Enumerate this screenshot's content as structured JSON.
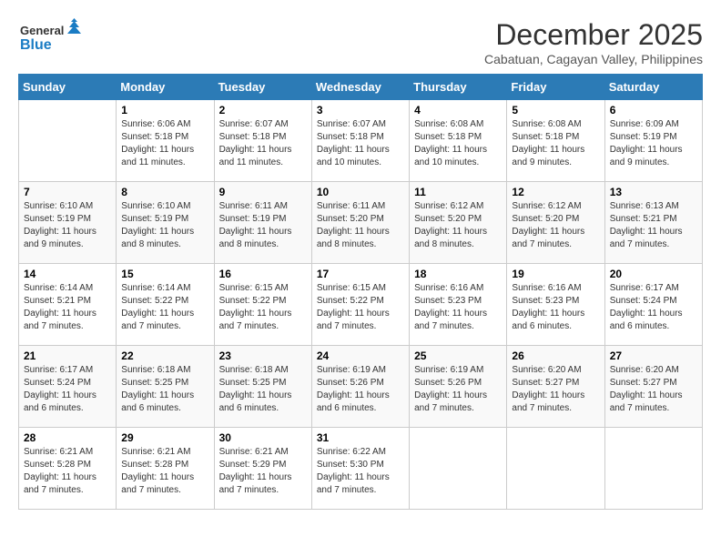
{
  "header": {
    "logo_line1": "General",
    "logo_line2": "Blue",
    "month": "December 2025",
    "location": "Cabatuan, Cagayan Valley, Philippines"
  },
  "weekdays": [
    "Sunday",
    "Monday",
    "Tuesday",
    "Wednesday",
    "Thursday",
    "Friday",
    "Saturday"
  ],
  "weeks": [
    [
      {
        "day": "",
        "info": ""
      },
      {
        "day": "1",
        "info": "Sunrise: 6:06 AM\nSunset: 5:18 PM\nDaylight: 11 hours and 11 minutes."
      },
      {
        "day": "2",
        "info": "Sunrise: 6:07 AM\nSunset: 5:18 PM\nDaylight: 11 hours and 11 minutes."
      },
      {
        "day": "3",
        "info": "Sunrise: 6:07 AM\nSunset: 5:18 PM\nDaylight: 11 hours and 10 minutes."
      },
      {
        "day": "4",
        "info": "Sunrise: 6:08 AM\nSunset: 5:18 PM\nDaylight: 11 hours and 10 minutes."
      },
      {
        "day": "5",
        "info": "Sunrise: 6:08 AM\nSunset: 5:18 PM\nDaylight: 11 hours and 9 minutes."
      },
      {
        "day": "6",
        "info": "Sunrise: 6:09 AM\nSunset: 5:19 PM\nDaylight: 11 hours and 9 minutes."
      }
    ],
    [
      {
        "day": "7",
        "info": "Sunrise: 6:10 AM\nSunset: 5:19 PM\nDaylight: 11 hours and 9 minutes."
      },
      {
        "day": "8",
        "info": "Sunrise: 6:10 AM\nSunset: 5:19 PM\nDaylight: 11 hours and 8 minutes."
      },
      {
        "day": "9",
        "info": "Sunrise: 6:11 AM\nSunset: 5:19 PM\nDaylight: 11 hours and 8 minutes."
      },
      {
        "day": "10",
        "info": "Sunrise: 6:11 AM\nSunset: 5:20 PM\nDaylight: 11 hours and 8 minutes."
      },
      {
        "day": "11",
        "info": "Sunrise: 6:12 AM\nSunset: 5:20 PM\nDaylight: 11 hours and 8 minutes."
      },
      {
        "day": "12",
        "info": "Sunrise: 6:12 AM\nSunset: 5:20 PM\nDaylight: 11 hours and 7 minutes."
      },
      {
        "day": "13",
        "info": "Sunrise: 6:13 AM\nSunset: 5:21 PM\nDaylight: 11 hours and 7 minutes."
      }
    ],
    [
      {
        "day": "14",
        "info": "Sunrise: 6:14 AM\nSunset: 5:21 PM\nDaylight: 11 hours and 7 minutes."
      },
      {
        "day": "15",
        "info": "Sunrise: 6:14 AM\nSunset: 5:22 PM\nDaylight: 11 hours and 7 minutes."
      },
      {
        "day": "16",
        "info": "Sunrise: 6:15 AM\nSunset: 5:22 PM\nDaylight: 11 hours and 7 minutes."
      },
      {
        "day": "17",
        "info": "Sunrise: 6:15 AM\nSunset: 5:22 PM\nDaylight: 11 hours and 7 minutes."
      },
      {
        "day": "18",
        "info": "Sunrise: 6:16 AM\nSunset: 5:23 PM\nDaylight: 11 hours and 7 minutes."
      },
      {
        "day": "19",
        "info": "Sunrise: 6:16 AM\nSunset: 5:23 PM\nDaylight: 11 hours and 6 minutes."
      },
      {
        "day": "20",
        "info": "Sunrise: 6:17 AM\nSunset: 5:24 PM\nDaylight: 11 hours and 6 minutes."
      }
    ],
    [
      {
        "day": "21",
        "info": "Sunrise: 6:17 AM\nSunset: 5:24 PM\nDaylight: 11 hours and 6 minutes."
      },
      {
        "day": "22",
        "info": "Sunrise: 6:18 AM\nSunset: 5:25 PM\nDaylight: 11 hours and 6 minutes."
      },
      {
        "day": "23",
        "info": "Sunrise: 6:18 AM\nSunset: 5:25 PM\nDaylight: 11 hours and 6 minutes."
      },
      {
        "day": "24",
        "info": "Sunrise: 6:19 AM\nSunset: 5:26 PM\nDaylight: 11 hours and 6 minutes."
      },
      {
        "day": "25",
        "info": "Sunrise: 6:19 AM\nSunset: 5:26 PM\nDaylight: 11 hours and 7 minutes."
      },
      {
        "day": "26",
        "info": "Sunrise: 6:20 AM\nSunset: 5:27 PM\nDaylight: 11 hours and 7 minutes."
      },
      {
        "day": "27",
        "info": "Sunrise: 6:20 AM\nSunset: 5:27 PM\nDaylight: 11 hours and 7 minutes."
      }
    ],
    [
      {
        "day": "28",
        "info": "Sunrise: 6:21 AM\nSunset: 5:28 PM\nDaylight: 11 hours and 7 minutes."
      },
      {
        "day": "29",
        "info": "Sunrise: 6:21 AM\nSunset: 5:28 PM\nDaylight: 11 hours and 7 minutes."
      },
      {
        "day": "30",
        "info": "Sunrise: 6:21 AM\nSunset: 5:29 PM\nDaylight: 11 hours and 7 minutes."
      },
      {
        "day": "31",
        "info": "Sunrise: 6:22 AM\nSunset: 5:30 PM\nDaylight: 11 hours and 7 minutes."
      },
      {
        "day": "",
        "info": ""
      },
      {
        "day": "",
        "info": ""
      },
      {
        "day": "",
        "info": ""
      }
    ]
  ]
}
